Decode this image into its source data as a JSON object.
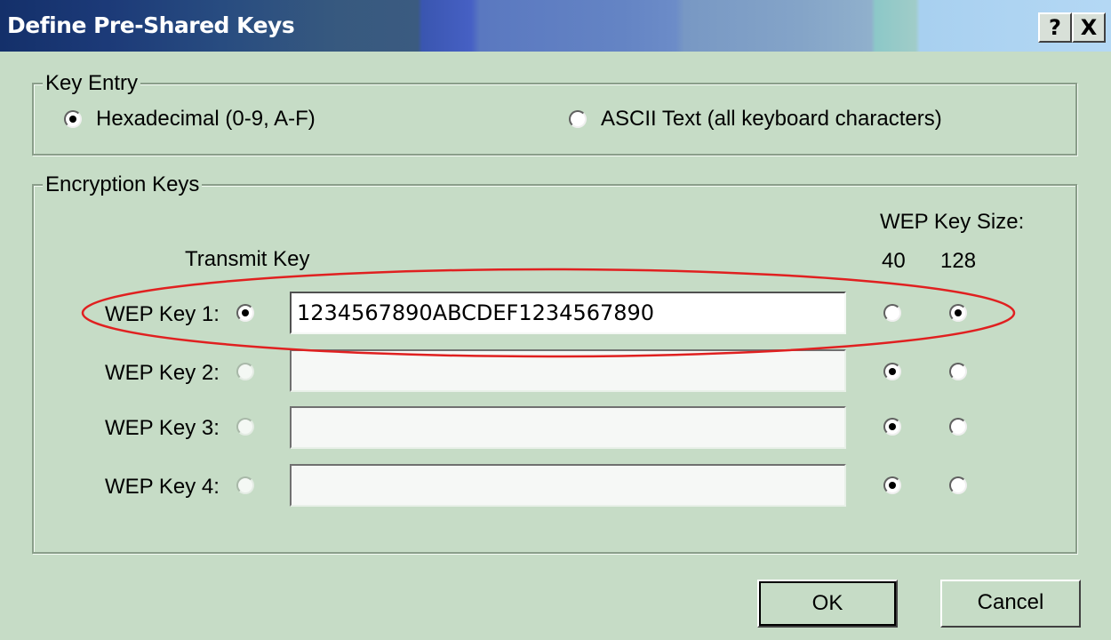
{
  "window": {
    "title": "Define Pre-Shared Keys",
    "help_label": "?",
    "close_label": "X"
  },
  "key_entry": {
    "legend": "Key Entry",
    "options": [
      {
        "label": "Hexadecimal (0-9, A-F)",
        "selected": true
      },
      {
        "label": "ASCII Text (all keyboard characters)",
        "selected": false
      }
    ]
  },
  "encryption_keys": {
    "legend": "Encryption Keys",
    "transmit_key_header": "Transmit Key",
    "wep_key_size_header": "WEP Key Size:",
    "size_options": [
      "40",
      "128"
    ],
    "keys": [
      {
        "label": "WEP Key 1:",
        "transmit": true,
        "value": "1234567890ABCDEF1234567890",
        "size": "128"
      },
      {
        "label": "WEP Key 2:",
        "transmit": false,
        "value": "",
        "size": "40"
      },
      {
        "label": "WEP Key 3:",
        "transmit": false,
        "value": "",
        "size": "40"
      },
      {
        "label": "WEP Key 4:",
        "transmit": false,
        "value": "",
        "size": "40"
      }
    ]
  },
  "buttons": {
    "ok": "OK",
    "cancel": "Cancel"
  },
  "colors": {
    "dialog_background": "#c6dcc6",
    "highlight_ellipse": "#e02020"
  }
}
